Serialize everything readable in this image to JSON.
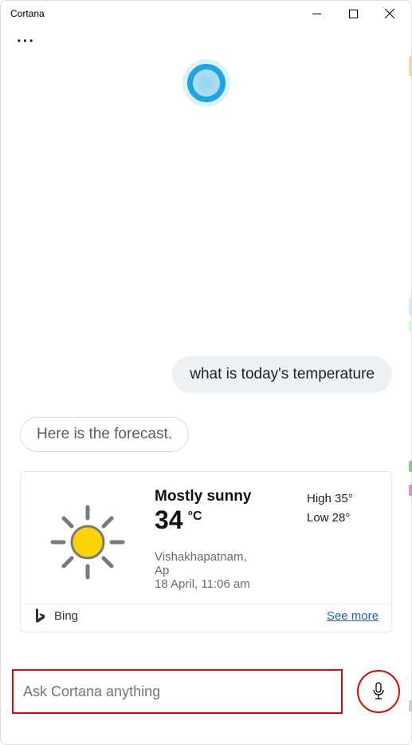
{
  "window": {
    "title": "Cortana"
  },
  "chat": {
    "user_msg": "what is today's temperature",
    "assistant_msg": "Here is the forecast."
  },
  "weather": {
    "condition": "Mostly sunny",
    "temperature": "34",
    "unit": "°C",
    "high_label": "High 35°",
    "low_label": "Low 28°",
    "location": "Vishakhapatnam,",
    "region": "Ap",
    "timestamp": "18 April, 11:06 am"
  },
  "card_footer": {
    "source": "Bing",
    "see_more": "See more"
  },
  "input": {
    "placeholder": "Ask Cortana anything"
  }
}
